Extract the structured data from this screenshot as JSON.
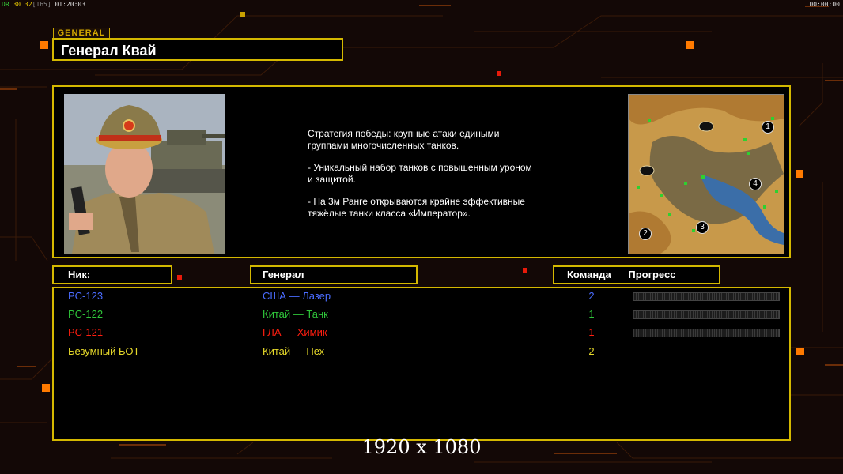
{
  "hud": {
    "left_indicator": "DR",
    "left_stats": "30 32",
    "left_bracket": "[165]",
    "left_time": "01:20:03",
    "right_time": "00:00:00"
  },
  "general_tag": "GENERAL",
  "title": "Генерал Квай",
  "description": [
    "Стратегия победы: крупные атаки едиными\n группами многочисленных танков.",
    "- Уникальный набор танков с повышенным уроном\n и защитой.",
    "- На 3м Ранге открываются крайне эффективные\n тяжёлые танки класса «Император»."
  ],
  "headers": {
    "nick": "Ник:",
    "general": "Генерал",
    "team": "Команда",
    "progress": "Прогресс"
  },
  "players": [
    {
      "nick": "PC-123",
      "general": "США — Лазер",
      "team": "2",
      "color": "#4a6cff"
    },
    {
      "nick": "PC-122",
      "general": "Китай — Танк",
      "team": "1",
      "color": "#2fc63a"
    },
    {
      "nick": "PC-121",
      "general": "ГЛА — Химик",
      "team": "1",
      "color": "#ff1e10"
    },
    {
      "nick": "Безумный БОТ",
      "general": "Китай — Пех",
      "team": "2",
      "color": "#e6d92a"
    }
  ],
  "map_markers": [
    "1",
    "2",
    "3",
    "4"
  ],
  "resolution_label": "1920 x 1080",
  "colors": {
    "frame": "#d4b800",
    "accent": "#ff7a00",
    "background": "#130806"
  }
}
